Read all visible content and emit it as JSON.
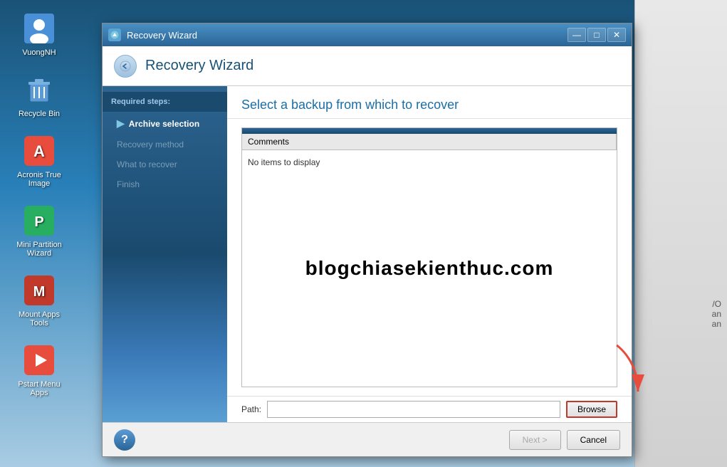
{
  "desktop": {
    "icons": [
      {
        "id": "vuongnh",
        "label": "VuongNH",
        "emoji": "👤",
        "color": "#4a90d9"
      },
      {
        "id": "recycle-bin",
        "label": "Recycle Bin",
        "emoji": "🗑",
        "color": "#888"
      },
      {
        "id": "acronis",
        "label": "Acronis True Image",
        "emoji": "🔵",
        "color": "#e74c3c"
      },
      {
        "id": "mini-partition",
        "label": "Mini Partition Wizard",
        "emoji": "🟢",
        "color": "#27ae60"
      },
      {
        "id": "mount-apps",
        "label": "Mount Apps Tools",
        "emoji": "🔴",
        "color": "#e74c3c"
      },
      {
        "id": "pstart",
        "label": "Pstart Menu Apps",
        "emoji": "🔴",
        "color": "#c0392b"
      }
    ]
  },
  "window": {
    "title": "Recovery Wizard",
    "header_title": "Recovery Wizard",
    "content_title": "Select a backup from which to recover",
    "required_steps_label": "Required steps:",
    "sidebar_items": [
      {
        "id": "archive-selection",
        "label": "Archive selection",
        "active": true
      },
      {
        "id": "recovery-method",
        "label": "Recovery method",
        "active": false
      },
      {
        "id": "what-to-recover",
        "label": "What to recover",
        "active": false
      },
      {
        "id": "finish",
        "label": "Finish",
        "active": false
      }
    ],
    "table": {
      "header_dark_bar": true,
      "columns": [
        "Comments"
      ],
      "no_items_text": "No items to display"
    },
    "watermark": "blogchiasekienthuc.com",
    "path_label": "Path:",
    "path_value": "",
    "browse_label": "Browse",
    "footer": {
      "next_label": "Next >",
      "cancel_label": "Cancel"
    },
    "bg_texts": [
      "/O",
      "an",
      "an"
    ]
  }
}
